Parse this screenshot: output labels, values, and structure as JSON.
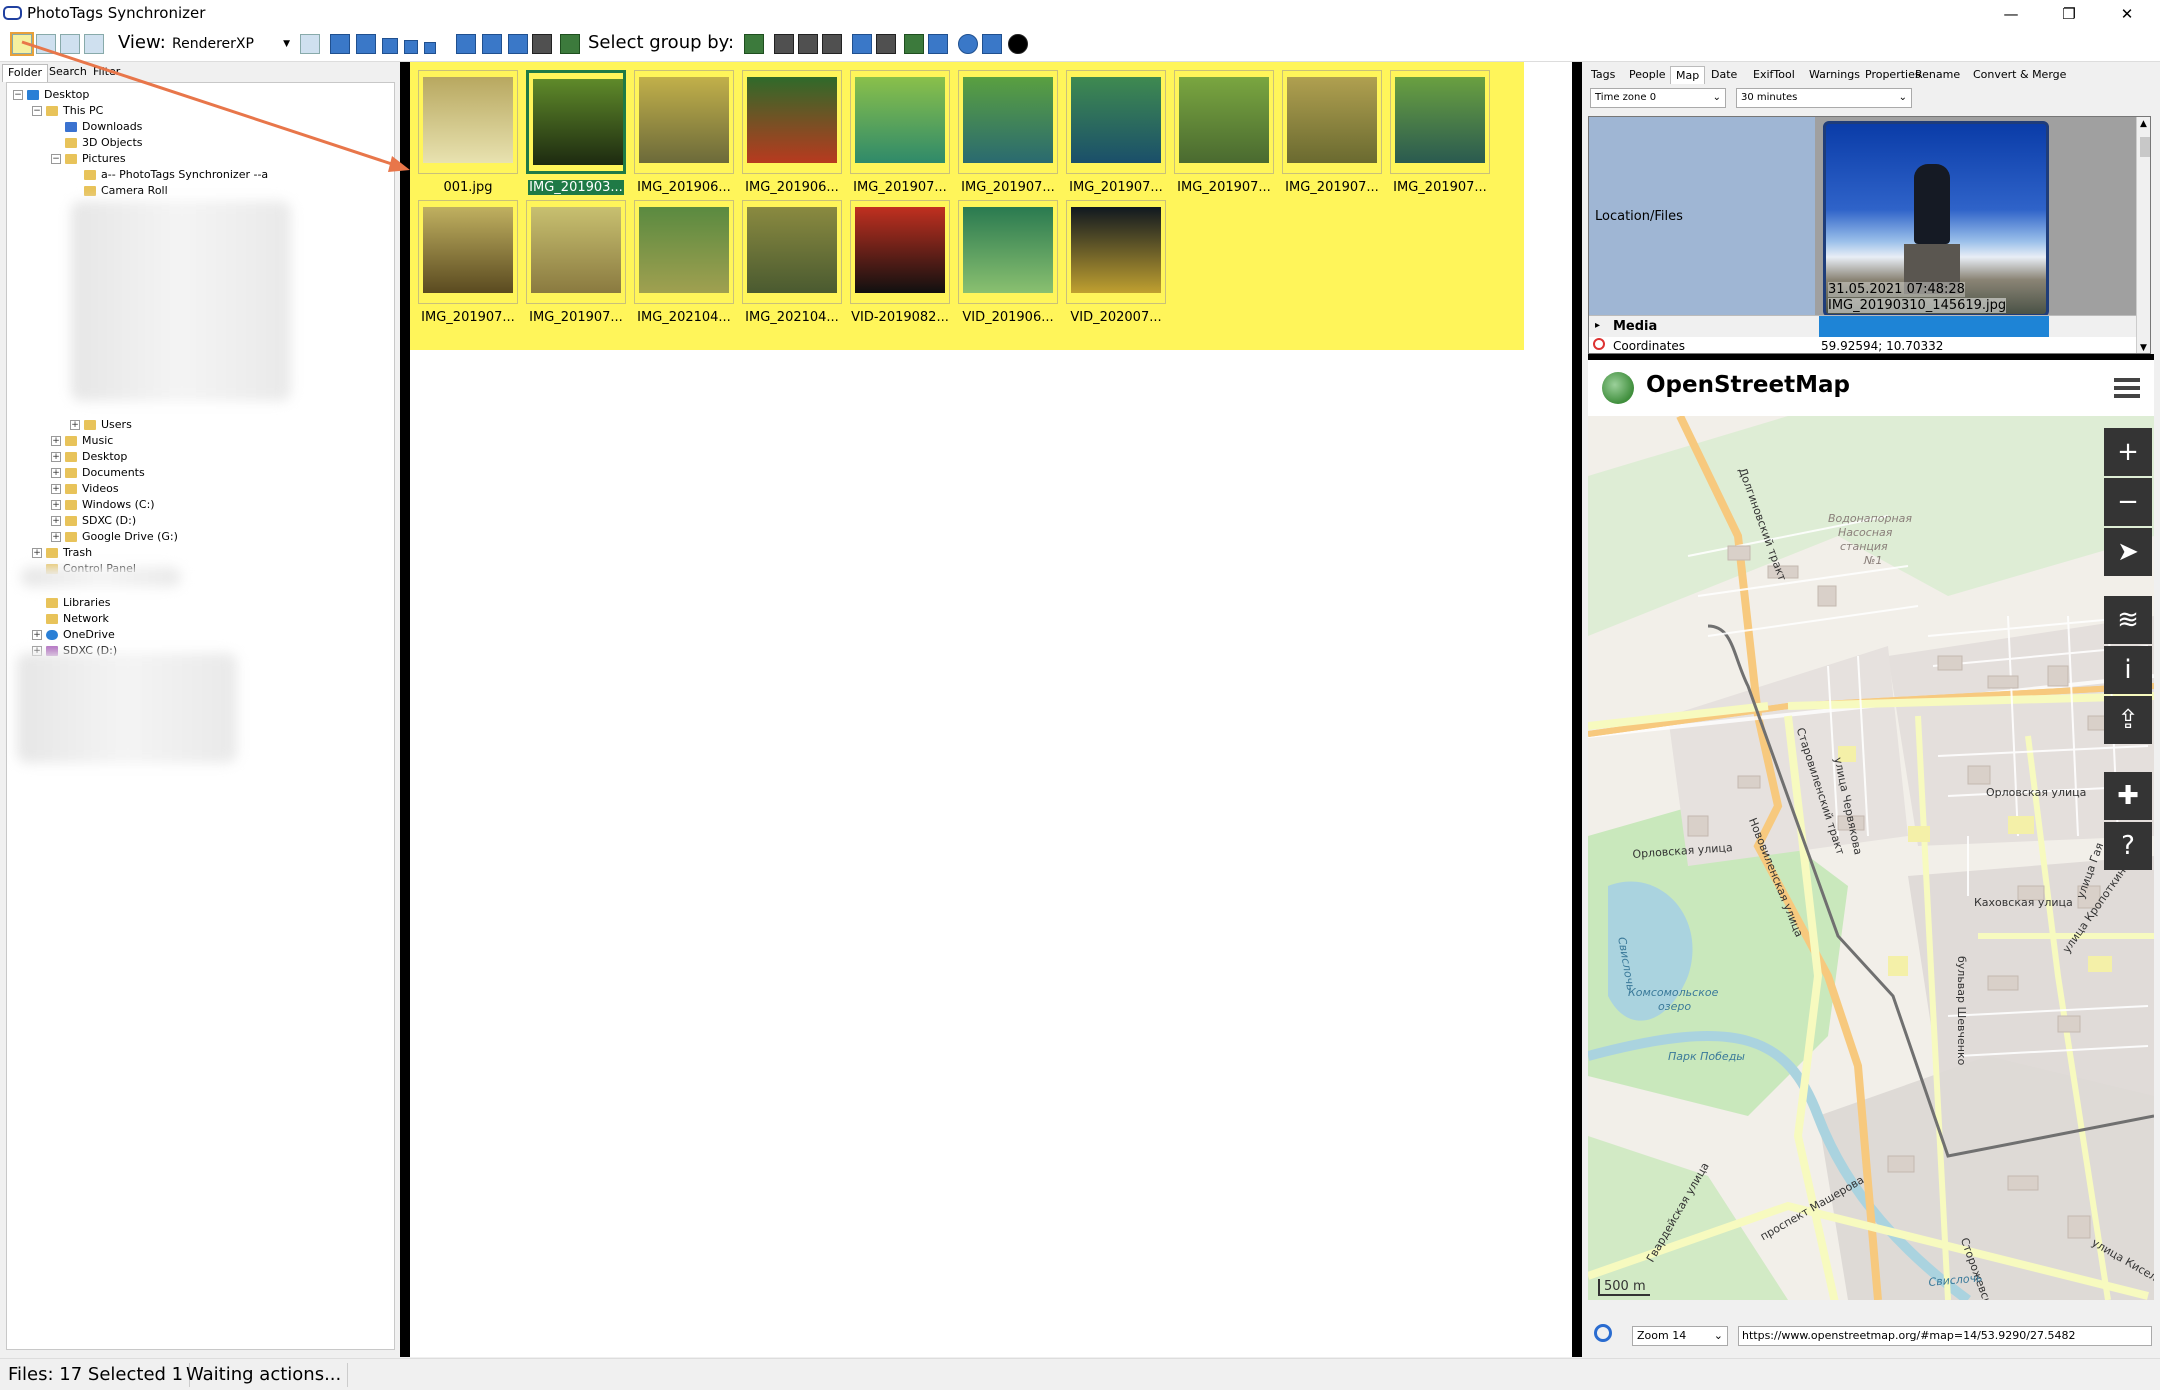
{
  "window": {
    "title": "PhotoTags Synchronizer",
    "minimize": "—",
    "maximize": "❐",
    "close": "✕"
  },
  "toolbar": {
    "view_label": "View:",
    "renderer": "RendererXP",
    "group_label": "Select group by:"
  },
  "left_tabs": [
    "Folder",
    "Search",
    "Filter"
  ],
  "tree": [
    {
      "label": "Desktop",
      "level": 0,
      "exp": "−",
      "icon": "blue"
    },
    {
      "label": "This PC",
      "level": 1,
      "exp": "−",
      "icon": "folder"
    },
    {
      "label": "Downloads",
      "level": 2,
      "exp": "",
      "icon": "dl"
    },
    {
      "label": "3D Objects",
      "level": 2,
      "exp": "",
      "icon": "folder"
    },
    {
      "label": "Pictures",
      "level": 2,
      "exp": "−",
      "icon": "folder"
    },
    {
      "label": "a-- PhotoTags Synchronizer --a",
      "level": 3,
      "exp": "",
      "icon": "folder"
    },
    {
      "label": "Camera Roll",
      "level": 3,
      "exp": "",
      "icon": "folder"
    },
    {
      "label": "Users",
      "level": 3,
      "exp": "+",
      "icon": "folder"
    },
    {
      "label": "Music",
      "level": 2,
      "exp": "+",
      "icon": "folder"
    },
    {
      "label": "Desktop",
      "level": 2,
      "exp": "+",
      "icon": "folder"
    },
    {
      "label": "Documents",
      "level": 2,
      "exp": "+",
      "icon": "folder"
    },
    {
      "label": "Videos",
      "level": 2,
      "exp": "+",
      "icon": "folder"
    },
    {
      "label": "Windows (C:)",
      "level": 2,
      "exp": "+",
      "icon": "folder"
    },
    {
      "label": "SDXC (D:)",
      "level": 2,
      "exp": "+",
      "icon": "folder"
    },
    {
      "label": "Google Drive (G:)",
      "level": 2,
      "exp": "+",
      "icon": "folder"
    },
    {
      "label": "Trash",
      "level": 1,
      "exp": "+",
      "icon": "folder"
    },
    {
      "label": "Control Panel",
      "level": 1,
      "exp": "",
      "icon": "folder"
    },
    {
      "label": "Libraries",
      "level": 1,
      "exp": "",
      "icon": "folder"
    },
    {
      "label": "Network",
      "level": 1,
      "exp": "",
      "icon": "folder"
    },
    {
      "label": "OneDrive",
      "level": 1,
      "exp": "+",
      "icon": "cloud"
    },
    {
      "label": "SDXC (D:)",
      "level": 1,
      "exp": "+",
      "icon": "sd"
    }
  ],
  "files": [
    {
      "name": "001.jpg",
      "selected": false,
      "c1": "#b8a860",
      "c2": "#e8e2b0"
    },
    {
      "name": "IMG_201903...",
      "selected": true,
      "c1": "#5f8a2a",
      "c2": "#1d2a10"
    },
    {
      "name": "IMG_201906...",
      "selected": false,
      "c1": "#c2b04a",
      "c2": "#6c6a3a"
    },
    {
      "name": "IMG_201906...",
      "selected": false,
      "c1": "#2f6a2a",
      "c2": "#b83a1f"
    },
    {
      "name": "IMG_201907...",
      "selected": false,
      "c1": "#8ac04a",
      "c2": "#2f8a6a"
    },
    {
      "name": "IMG_201907...",
      "selected": false,
      "c1": "#5aa040",
      "c2": "#2a6a70"
    },
    {
      "name": "IMG_201907...",
      "selected": false,
      "c1": "#3f8a50",
      "c2": "#1a4f6a"
    },
    {
      "name": "IMG_201907...",
      "selected": false,
      "c1": "#7aa640",
      "c2": "#4a6a30"
    },
    {
      "name": "IMG_201907...",
      "selected": false,
      "c1": "#b0a050",
      "c2": "#6a6a30"
    },
    {
      "name": "IMG_201907...",
      "selected": false,
      "c1": "#6aa040",
      "c2": "#2a5a50"
    },
    {
      "name": "IMG_201907...",
      "selected": false,
      "c1": "#c0b060",
      "c2": "#5a4a20"
    },
    {
      "name": "IMG_201907...",
      "selected": false,
      "c1": "#c8c070",
      "c2": "#8a7a40"
    },
    {
      "name": "IMG_202104...",
      "selected": false,
      "c1": "#5a8a40",
      "c2": "#a0a050"
    },
    {
      "name": "IMG_202104...",
      "selected": false,
      "c1": "#8a8a40",
      "c2": "#4a5a30"
    },
    {
      "name": "VID-2019082...",
      "selected": false,
      "c1": "#c03020",
      "c2": "#101010"
    },
    {
      "name": "VID_201906...",
      "selected": false,
      "c1": "#2a7a50",
      "c2": "#8ac070"
    },
    {
      "name": "VID_202007...",
      "selected": false,
      "c1": "#101820",
      "c2": "#c0a030"
    }
  ],
  "right_tabs": [
    "Tags",
    "People",
    "Map",
    "Date",
    "ExifTool",
    "Warnings",
    "Properties",
    "Rename",
    "Convert & Merge"
  ],
  "timezone": "Time zone 0",
  "interval": "30 minutes",
  "location_label": "Location/Files",
  "photo": {
    "date": "31.05.2021 07:48:28",
    "file": "IMG_20190310_145619.jpg"
  },
  "media_label": "Media",
  "coord_label": "Coordinates",
  "coord_value": "59.92594; 10.70332",
  "osm_title": "OpenStreetMap",
  "map": {
    "controls": [
      "+",
      "−",
      "➤",
      "≋",
      "i",
      "⇪",
      "✚",
      "?"
    ],
    "labels": [
      "Водонапорная",
      "Насосная",
      "станция",
      "№1",
      "Орловская улица",
      "Орловская улица",
      "Каховская улица",
      "Комсомольское",
      "озеро",
      "Парк Победы",
      "Долгиновский тракт",
      "Старовиленский тракт",
      "улица Червякова",
      "бульвар Шевченко",
      "улица Гая",
      "улица Кропоткина",
      "проспект Машерова",
      "Сторожевская улица",
      "Гвардейская улица",
      "улица Киселёва",
      "Свислочь",
      "Свислочь",
      "Нововиленская улица"
    ],
    "scale": "500 m"
  },
  "zoom": "Zoom 14",
  "url": "https://www.openstreetmap.org/#map=14/53.9290/27.5482",
  "status": {
    "files": "Files: 17 Selected 1",
    "action": "Waiting actions..."
  },
  "colors": {
    "grid_bg": "#fff55a",
    "selected": "#1f7a46",
    "accent_arrow": "#e8764a"
  }
}
